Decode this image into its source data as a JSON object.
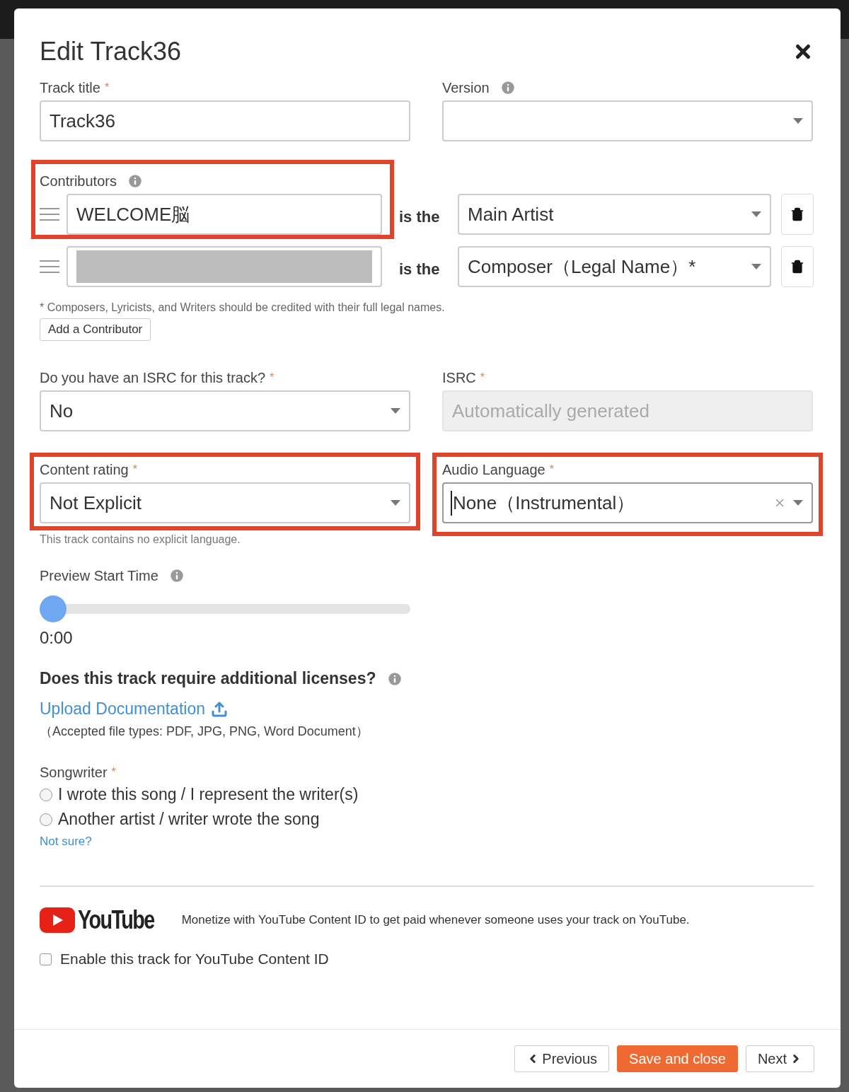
{
  "dialog": {
    "title": "Edit Track36"
  },
  "track_title": {
    "label": "Track title",
    "required_mark": "*",
    "value": "Track36"
  },
  "version": {
    "label": "Version",
    "info": true
  },
  "contributors": {
    "label": "Contributors",
    "info": true,
    "highlighted": true,
    "rows": [
      {
        "name": "WELCOME脳",
        "redacted": false,
        "connector": "is the",
        "role": "Main Artist"
      },
      {
        "redacted": true,
        "connector": "is the",
        "role": "Composer（Legal Name）*"
      }
    ],
    "note": "* Composers, Lyricists, and Writers should be credited with their full legal names.",
    "add_button": "Add a Contributor"
  },
  "isrc_question": {
    "label": "Do you have an ISRC for this track?",
    "required_mark": "*",
    "value": "No"
  },
  "isrc": {
    "label": "ISRC",
    "required_mark": "*",
    "placeholder": "Automatically generated",
    "disabled": true
  },
  "content_rating": {
    "label": "Content rating",
    "required_mark": "*",
    "value": "Not Explicit",
    "hint": "This track contains no explicit language.",
    "highlighted": true
  },
  "audio_language": {
    "label": "Audio Language",
    "required_mark": "*",
    "value": "None（Instrumental）",
    "clearable": true,
    "highlighted": true
  },
  "preview": {
    "label": "Preview Start Time",
    "info": true,
    "level": 0,
    "reading": "0:00"
  },
  "licenses": {
    "question": "Does this track require additional licenses?",
    "info": true,
    "link": "Upload Documentation",
    "note": "（Accepted file types: PDF, JPG, PNG, Word Document）"
  },
  "songwriter": {
    "label": "Songwriter",
    "required_mark": "*",
    "options": [
      {
        "label": "I wrote this song / I represent the writer(s)",
        "selected": false
      },
      {
        "label": "Another artist / writer wrote the song",
        "selected": false
      }
    ],
    "help_link": "Not sure?"
  },
  "youtube": {
    "logo": "YouTube",
    "text": "Monetize with YouTube Content ID to get paid whenever someone uses your track on YouTube.",
    "checkbox": {
      "label": "Enable this track for YouTube Content ID",
      "checked": false
    }
  },
  "footer": {
    "buttons": [
      {
        "label": "Previous",
        "kind": "previous"
      },
      {
        "label": "Save and close",
        "kind": "primary"
      },
      {
        "label": "Next",
        "kind": "next"
      }
    ]
  }
}
